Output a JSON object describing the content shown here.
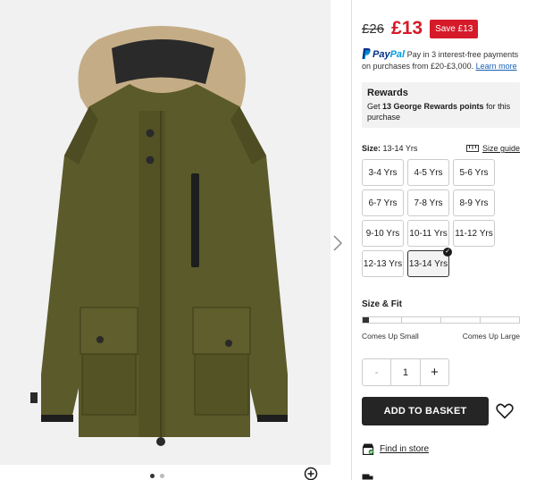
{
  "price": {
    "was": "£26",
    "now": "£13",
    "save": "Save £13"
  },
  "paypal": {
    "brand_pay": "Pay",
    "brand_pal": "Pal",
    "text": "Pay in 3 interest-free payments on purchases from £20-£3,000.",
    "learn_more": "Learn more"
  },
  "rewards": {
    "title": "Rewards",
    "prefix": "Get ",
    "points": "13 George Rewards points",
    "suffix": " for this purchase"
  },
  "size": {
    "label": "Size:",
    "selected": "13-14 Yrs",
    "guide": "Size guide",
    "options": [
      "3-4 Yrs",
      "4-5 Yrs",
      "5-6 Yrs",
      "6-7 Yrs",
      "7-8 Yrs",
      "8-9 Yrs",
      "9-10 Yrs",
      "10-11 Yrs",
      "11-12 Yrs",
      "12-13 Yrs",
      "13-14 Yrs"
    ],
    "selected_index": 10
  },
  "fit": {
    "title": "Size & Fit",
    "left": "Comes Up Small",
    "right": "Comes Up Large",
    "level": 0
  },
  "quantity": {
    "value": "1",
    "minus": "-",
    "plus": "+"
  },
  "basket": {
    "label": "ADD TO BASKET"
  },
  "store": {
    "find": "Find in store"
  },
  "colors": {
    "accent": "#d61a2a",
    "dark": "#252525",
    "jacket": "#5b5a2a"
  },
  "gallery": {
    "dots": 2,
    "active_dot": 0
  }
}
